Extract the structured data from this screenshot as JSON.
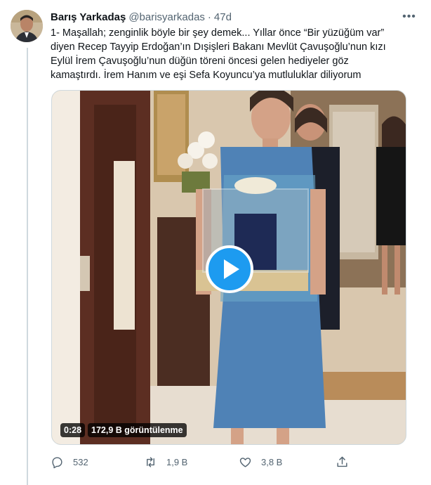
{
  "tweet": {
    "author_name": "Barış Yarkadaş",
    "author_handle": "@barisyarkadas",
    "separator": "·",
    "timestamp": "47d",
    "more_icon": "more-horizontal-icon",
    "text": "1- Maşallah; zenginlik böyle bir şey demek... Yıllar önce “Bir yüzüğüm var” diyen Recep Tayyip Erdoğan’ın Dışişleri Bakanı Mevlüt Çavuşoğlu’nun kızı Eylül İrem Çavuşoğlu’nun düğün töreni öncesi gelen hediyeler göz kamaştırdı. İrem Hanım ve eşi Sefa Koyuncu’ya mutluluklar diliyorum"
  },
  "video": {
    "duration": "0:28",
    "views": "172,9 B görüntülenme",
    "play_icon": "play-icon",
    "accent_color": "#1d9bf0"
  },
  "actions": {
    "reply_count": "532",
    "retweet_count": "1,9 B",
    "like_count": "3,8 B",
    "text_color": "#536471"
  }
}
